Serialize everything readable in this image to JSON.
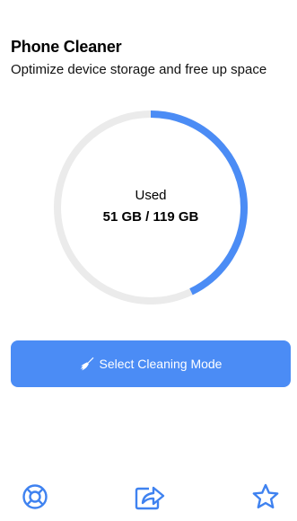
{
  "header": {
    "title": "Phone Cleaner",
    "subtitle": "Optimize device storage and free up space"
  },
  "storage": {
    "label": "Used",
    "value_text": "51 GB / 119 GB",
    "used_gb": 51,
    "total_gb": 119
  },
  "action": {
    "label": "Select Cleaning Mode",
    "icon": "broom-icon"
  },
  "tabbar": {
    "items": [
      {
        "icon": "lifebuoy-icon"
      },
      {
        "icon": "share-icon"
      },
      {
        "icon": "star-icon"
      }
    ]
  },
  "colors": {
    "accent": "#4b8cf5",
    "track": "#ebebeb",
    "text": "#000000",
    "button_text": "#ffffff"
  }
}
